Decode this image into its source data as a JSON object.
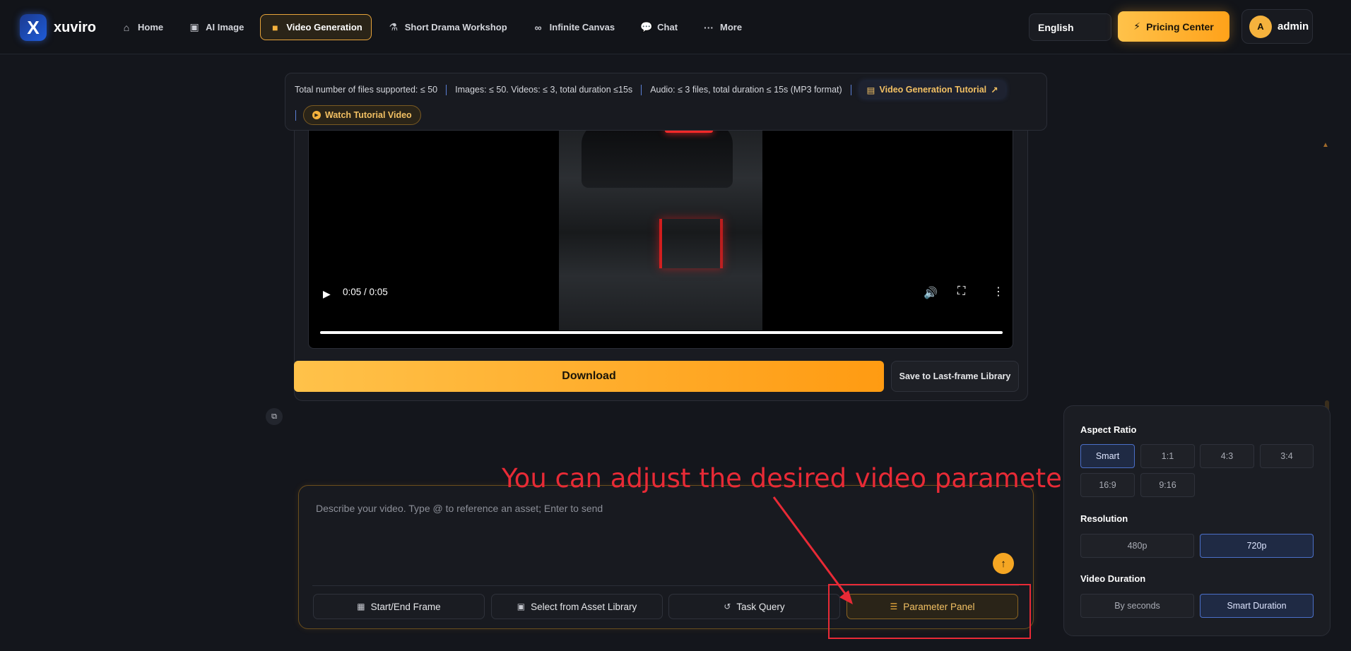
{
  "brand": {
    "name": "xuviro",
    "logo_letter": "X"
  },
  "nav": {
    "items": [
      {
        "label": "Home",
        "icon": "home-icon",
        "glyph": "⌂"
      },
      {
        "label": "AI Image",
        "icon": "image-icon",
        "glyph": "▣"
      },
      {
        "label": "Video Generation",
        "icon": "video-camera-icon",
        "glyph": "■",
        "active": true
      },
      {
        "label": "Short Drama Workshop",
        "icon": "flask-icon",
        "glyph": "⚗"
      },
      {
        "label": "Infinite Canvas",
        "icon": "infinity-icon",
        "glyph": "∞"
      },
      {
        "label": "Chat",
        "icon": "chat-bubbles-icon",
        "glyph": "💬"
      },
      {
        "label": "More",
        "icon": "ellipsis-icon",
        "glyph": "···"
      }
    ],
    "language": "English",
    "pricing_label": "Pricing Center",
    "user": {
      "avatar_letter": "A",
      "name": "admin"
    }
  },
  "info": {
    "files": "Total number of files supported: ≤ 50",
    "images_videos": "Images: ≤ 50. Videos: ≤ 3, total duration ≤15s",
    "audio": "Audio: ≤ 3 files, total duration ≤ 15s (MP3 format)",
    "tutorial_link": "Video Generation Tutorial",
    "watch_label": "Watch Tutorial Video"
  },
  "player": {
    "time": "0:05 / 0:05",
    "progress": 1.0
  },
  "result": {
    "download_label": "Download",
    "save_label": "Save to Last-frame Library"
  },
  "composer": {
    "placeholder": "Describe your video. Type @ to reference an asset; Enter to send",
    "tools": [
      {
        "label": "Start/End Frame",
        "icon": "film-frame-icon"
      },
      {
        "label": "Select from Asset Library",
        "icon": "images-icon"
      },
      {
        "label": "Task Query",
        "icon": "history-icon"
      },
      {
        "label": "Parameter Panel",
        "icon": "sliders-icon"
      }
    ]
  },
  "annotation": {
    "text": "You can adjust the desired video parameters here",
    "color": "#e82a36"
  },
  "params": {
    "aspect_ratio": {
      "title": "Aspect Ratio",
      "options": [
        "Smart",
        "1:1",
        "4:3",
        "3:4",
        "16:9",
        "9:16"
      ],
      "selected": "Smart"
    },
    "resolution": {
      "title": "Resolution",
      "options": [
        "480p",
        "720p"
      ],
      "selected": "720p"
    },
    "duration": {
      "title": "Video Duration",
      "options": [
        "By seconds",
        "Smart Duration"
      ],
      "selected": "Smart Duration"
    }
  },
  "colors": {
    "accent": "#f5a623",
    "background": "#14161c",
    "selected": "#4b6fc8"
  }
}
